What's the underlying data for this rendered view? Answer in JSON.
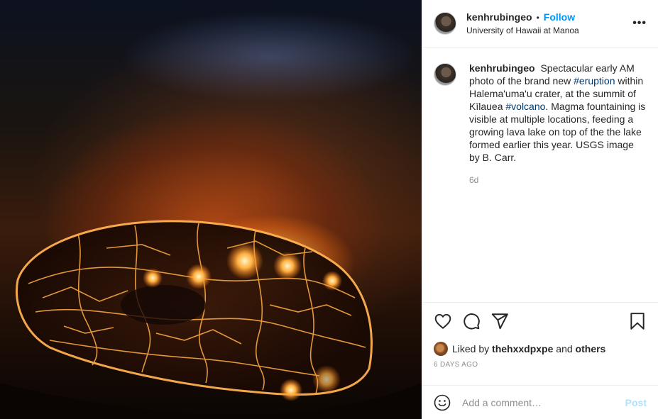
{
  "photo": {
    "alt": "Lava lake in Halema'uma'u crater at night"
  },
  "header": {
    "username": "kenhrubingeo",
    "separator": "•",
    "follow_label": "Follow",
    "location": "University of Hawaii at Manoa",
    "more_label": "•••"
  },
  "caption": {
    "username": "kenhrubingeo",
    "part1": "Spectacular early AM photo of the brand new ",
    "tag1": "#eruption",
    "part2": " within Halema'uma'u crater, at the summit of Kīlauea ",
    "tag2": "#volcano",
    "part3": ". Magma fountaining is visible at multiple locations, feeding a growing lava lake on top of the the lake formed earlier this year. USGS image by B. Carr.",
    "time_ago": "6d"
  },
  "actions": {
    "icons": [
      "heart-icon",
      "comment-icon",
      "share-icon",
      "bookmark-icon"
    ]
  },
  "likes": {
    "prefix": "Liked by ",
    "user": "thehxxdpxpe",
    "conj": " and ",
    "others": "others"
  },
  "date": "6 DAYS AGO",
  "comment": {
    "placeholder": "Add a comment…",
    "post_label": "Post"
  },
  "colors": {
    "link": "#0095f6",
    "hashtag": "#00376b",
    "post_disabled": "#b2dffc",
    "muted": "#8e8e8e"
  }
}
